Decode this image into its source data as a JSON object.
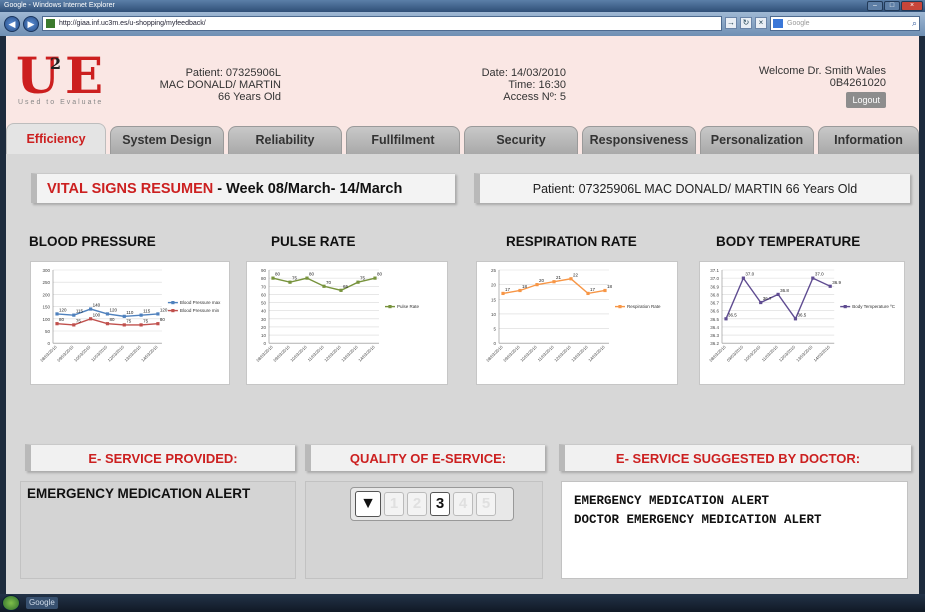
{
  "browser": {
    "title": "Google - Windows Internet Explorer",
    "url": "http://giaa.inf.uc3m.es/u-shopping/myfeedback/",
    "search_placeholder": "Google"
  },
  "logo": {
    "tagline": "Used to Evaluate",
    "letters": {
      "u": "U",
      "two": "2",
      "e": "E"
    }
  },
  "patient": {
    "id_line": "Patient: 07325906L",
    "name_line": "MAC DONALD/ MARTIN",
    "age_line": "66 Years Old"
  },
  "visit": {
    "date_line": "Date: 14/03/2010",
    "time_line": "Time: 16:30",
    "access_line": "Access Nº: 5"
  },
  "doctor": {
    "welcome_line": "Welcome Dr. Smith Wales",
    "code_line": "0B4261020",
    "logout_label": "Logout"
  },
  "tabs": [
    {
      "label": "Efficiency",
      "active": true
    },
    {
      "label": "System Design",
      "active": false
    },
    {
      "label": "Reliability",
      "active": false
    },
    {
      "label": "Fullfilment",
      "active": false
    },
    {
      "label": "Security",
      "active": false
    },
    {
      "label": "Responsiveness",
      "active": false
    },
    {
      "label": "Personalization",
      "active": false
    },
    {
      "label": "Information",
      "active": false
    }
  ],
  "summary": {
    "title_highlight": "VITAL SIGNS RESUMEN",
    "title_rest": " - Week 08/March- 14/March",
    "patient_line": "Patient: 07325906L MAC DONALD/ MARTIN 66 Years Old"
  },
  "charts": {
    "blood_pressure_title": "BLOOD PRESSURE",
    "pulse_rate_title": "PULSE RATE",
    "respiration_rate_title": "RESPIRATION RATE",
    "body_temperature_title": "BODY TEMPERATURE"
  },
  "chart_data": [
    {
      "type": "line",
      "title": "BLOOD PRESSURE",
      "categories": [
        "08/03/2010",
        "09/03/2010",
        "10/03/2010",
        "11/03/2010",
        "12/03/2010",
        "13/03/2010",
        "14/03/2010"
      ],
      "ylim": [
        0,
        300
      ],
      "yticks": [
        0,
        50,
        100,
        150,
        200,
        250,
        300
      ],
      "series": [
        {
          "name": "Blood Pressure max",
          "color": "#4f81bd",
          "values": [
            120,
            115,
            140,
            120,
            110,
            115,
            120
          ]
        },
        {
          "name": "Blood Pressure min",
          "color": "#c0504d",
          "values": [
            80,
            75,
            100,
            80,
            75,
            75,
            80
          ]
        }
      ],
      "value_labels": [
        "120",
        "115",
        "140",
        "120",
        "110",
        "115",
        "120",
        "80",
        "75",
        "100",
        "80",
        "75",
        "75",
        "80"
      ],
      "legend": "right"
    },
    {
      "type": "line",
      "title": "PULSE RATE",
      "categories": [
        "08/03/2010",
        "09/03/2010",
        "10/03/2010",
        "11/03/2010",
        "12/03/2010",
        "13/03/2010",
        "14/03/2010"
      ],
      "ylim": [
        0,
        90
      ],
      "yticks": [
        0,
        10,
        20,
        30,
        40,
        50,
        60,
        70,
        80,
        90
      ],
      "series": [
        {
          "name": "Pulse Rate",
          "color": "#77933c",
          "values": [
            80,
            75,
            80,
            70,
            65,
            75,
            80
          ]
        }
      ],
      "value_labels": [
        "80",
        "75",
        "80",
        "70",
        "65",
        "75",
        "80"
      ],
      "legend": "right"
    },
    {
      "type": "line",
      "title": "RESPIRATION RATE",
      "categories": [
        "08/03/2010",
        "09/03/2010",
        "10/03/2010",
        "11/03/2010",
        "12/03/2010",
        "13/03/2010",
        "14/03/2010"
      ],
      "ylim": [
        0,
        25
      ],
      "yticks": [
        0,
        5,
        10,
        15,
        20,
        25
      ],
      "series": [
        {
          "name": "Respiration Rate",
          "color": "#f79646",
          "values": [
            17,
            18,
            20,
            21,
            22,
            17,
            18
          ]
        }
      ],
      "value_labels": [
        "17",
        "18",
        "20",
        "21",
        "22",
        "17",
        "18"
      ],
      "legend": "right"
    },
    {
      "type": "line",
      "title": "BODY TEMPERATURE",
      "categories": [
        "08/03/2010",
        "09/03/2010",
        "10/03/2010",
        "11/03/2010",
        "12/03/2010",
        "13/03/2010",
        "14/03/2010"
      ],
      "ylim": [
        36.2,
        37.1
      ],
      "yticks": [
        36.2,
        36.3,
        36.4,
        36.5,
        36.6,
        36.7,
        36.8,
        36.9,
        37.0,
        37.1
      ],
      "series": [
        {
          "name": "Body Temperature ºC",
          "color": "#5f4c91",
          "values": [
            36.5,
            37.0,
            36.7,
            36.8,
            36.5,
            37.0,
            36.9
          ]
        }
      ],
      "value_labels": [
        "36.5",
        "37.0",
        "36.7",
        "36.8",
        "36.5",
        "37.0",
        "36.9"
      ],
      "legend": "right"
    }
  ],
  "sections": {
    "provided_title": "E- SERVICE PROVIDED:",
    "quality_title": "QUALITY OF E-SERVICE:",
    "suggested_title": "E- SERVICE SUGGESTED BY DOCTOR:",
    "provided_value": "EMERGENCY MEDICATION ALERT",
    "suggested_lines": [
      "EMERGENCY MEDICATION ALERT",
      "DOCTOR EMERGENCY MEDICATION ALERT"
    ]
  },
  "rating": {
    "options": [
      "1",
      "2",
      "3",
      "4",
      "5"
    ],
    "selected": "3",
    "selected_index": 2,
    "toggle_icon": "triangle-down-icon"
  },
  "taskbar": {
    "items": [
      "Google"
    ]
  }
}
